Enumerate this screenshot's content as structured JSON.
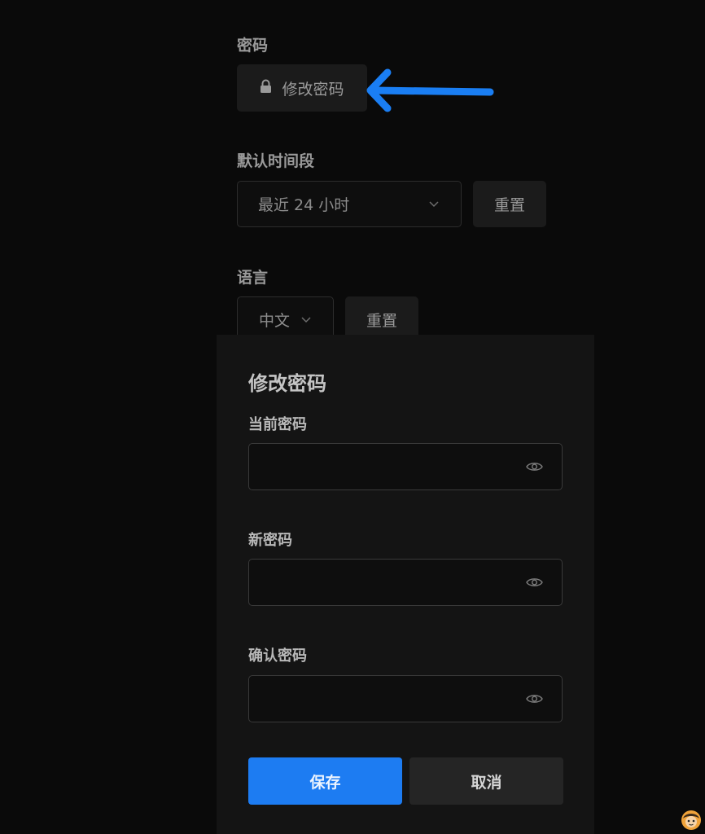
{
  "settings": {
    "password": {
      "label": "密码",
      "change_button": "修改密码",
      "button_icon": "lock-icon"
    },
    "time_range": {
      "label": "默认时间段",
      "selected": "最近 24 小时",
      "reset_button": "重置"
    },
    "language": {
      "label": "语言",
      "selected": "中文",
      "reset_button": "重置"
    }
  },
  "annotation": {
    "arrow_color": "#1a7ef3",
    "icon": "arrow-left-icon"
  },
  "modal": {
    "title": "修改密码",
    "fields": [
      {
        "label": "当前密码",
        "value": "",
        "icon": "eye-icon"
      },
      {
        "label": "新密码",
        "value": "",
        "icon": "eye-icon"
      },
      {
        "label": "确认密码",
        "value": "",
        "icon": "eye-icon"
      }
    ],
    "save_button": "保存",
    "cancel_button": "取消"
  },
  "colors": {
    "background": "#0a0a0a",
    "modal": "#141414",
    "primary": "#1d7cf2"
  }
}
